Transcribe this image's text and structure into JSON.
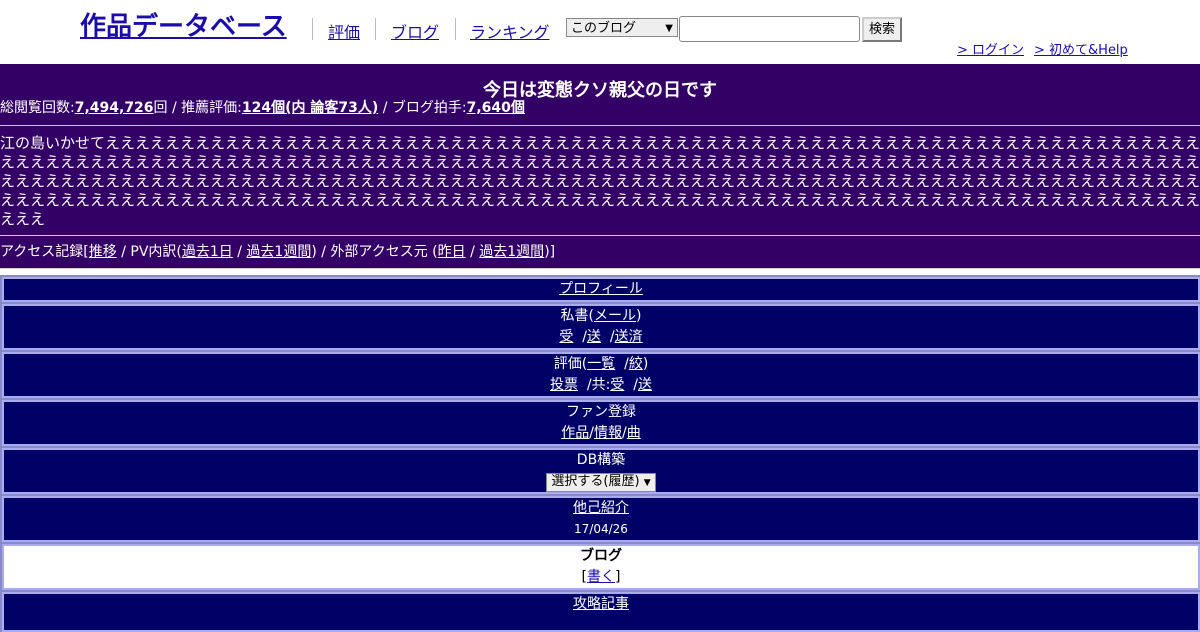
{
  "header": {
    "site_title": "作品データベース",
    "nav": [
      "評価",
      "ブログ",
      "ランキング"
    ],
    "search_select": "このブログ",
    "search_placeholder": "",
    "search_button": "検索",
    "login": "> ログイン",
    "help": "> 初めて&Help"
  },
  "blog": {
    "title": "今日は変態クソ親父の日です",
    "stats": {
      "views_label": "総閲覧回数:",
      "views": "7,494,726",
      "views_unit": "回 / 推薦評価:",
      "recommend": "124個(内 論客73人)",
      "clap_label": " / ブログ拍手:",
      "clap": "7,640個"
    },
    "description": "江の島いかせてええええええええええええええええええええええええええええええええええええええええええええええええええええええええええええええええええええええええええええええええええええええええええええええええええええええええええええええええええええええええええええええええええええええええええええええええええええええええええええええええええええええええええええええええええええええええええええええええええええええええええええええええええええええええええええええええええええええええええええええええええええええええええええええええええええええええええええええええええええええええええええええええええええええええええええええええええええええええええええ",
    "access": {
      "label": "アクセス記録[",
      "trend": "推移",
      "pv_label": " / PV内訳(",
      "pv_day": "過去1日",
      "sep": " / ",
      "pv_week": "過去1週間",
      "ext_label": ") / 外部アクセス元 (",
      "ext_day": "昨日",
      "ext_week": "過去1週間",
      "end": ")]"
    }
  },
  "panel": {
    "profile": "プロフィール",
    "secretary": {
      "label": "私書(",
      "mail": "メール",
      "close": ")",
      "recv": "受",
      "send": "送",
      "sent": "送済"
    },
    "rating": {
      "label": "評価(",
      "list": "一覧",
      "filter": "絞",
      "close": ")",
      "vote": "投票",
      "shared": "/共:",
      "recv": "受",
      "send": "送"
    },
    "fan": {
      "label": "ファン登録",
      "works": "作品",
      "info": "情報",
      "music": "曲"
    },
    "db": {
      "label": "DB構築",
      "select": "選択する(履歴)"
    },
    "intro": {
      "label": "他己紹介",
      "date": "17/04/26"
    },
    "blog": {
      "label": "ブログ",
      "write": "書く"
    },
    "strategy": "攻略記事"
  }
}
